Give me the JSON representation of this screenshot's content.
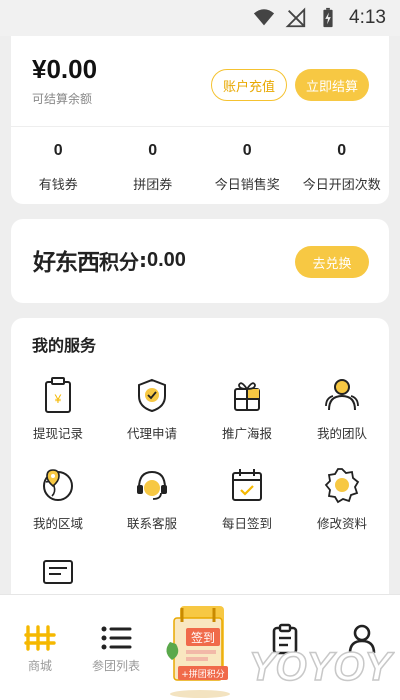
{
  "status_bar": {
    "time": "4:13"
  },
  "balance": {
    "amount": "¥0.00",
    "label": "可结算余额",
    "recharge_label": "账户充值",
    "settle_label": "立即结算"
  },
  "stats": [
    {
      "value": "0",
      "label": "有钱券"
    },
    {
      "value": "0",
      "label": "拼团券"
    },
    {
      "value": "0",
      "label": "今日销售奖"
    },
    {
      "value": "0",
      "label": "今日开团次数"
    }
  ],
  "points": {
    "logo_text": "好东西",
    "label": "积分",
    "colon": ":",
    "value": "0.00",
    "redeem_label": "去兑换"
  },
  "services": {
    "title": "我的服务",
    "items": [
      {
        "label": "提现记录",
        "icon": "withdraw-record-icon"
      },
      {
        "label": "代理申请",
        "icon": "agent-apply-icon"
      },
      {
        "label": "推广海报",
        "icon": "gift-poster-icon"
      },
      {
        "label": "我的团队",
        "icon": "team-icon"
      },
      {
        "label": "我的区域",
        "icon": "region-icon"
      },
      {
        "label": "联系客服",
        "icon": "customer-service-icon"
      },
      {
        "label": "每日签到",
        "icon": "daily-checkin-icon"
      },
      {
        "label": "修改资料",
        "icon": "settings-icon"
      },
      {
        "label": "",
        "icon": "document-icon"
      }
    ]
  },
  "tabbar": {
    "items": [
      {
        "label": "商城",
        "icon": "mall-icon"
      },
      {
        "label": "参团列表",
        "icon": "list-icon"
      },
      {
        "label": "",
        "icon": "checkin-promo"
      },
      {
        "label": "",
        "icon": "clipboard-icon"
      },
      {
        "label": "",
        "icon": "user-icon"
      }
    ]
  },
  "promo": {
    "sign_text": "签到",
    "badge_text": "+拼团积分"
  },
  "watermark": {
    "text": "YOYOY"
  },
  "colors": {
    "accent": "#f7c843",
    "accent_text": "#e8a800",
    "background": "#eeeeee"
  }
}
